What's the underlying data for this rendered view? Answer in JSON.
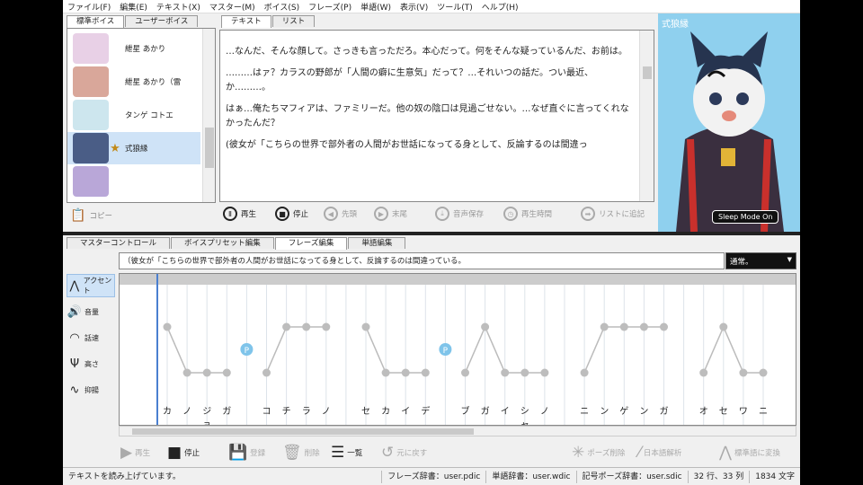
{
  "menu": [
    "ファイル(F)",
    "編集(E)",
    "テキスト(X)",
    "マスター(M)",
    "ボイス(S)",
    "フレーズ(P)",
    "単語(W)",
    "表示(V)",
    "ツール(T)",
    "ヘルプ(H)"
  ],
  "voice_tabs": [
    "標準ボイス",
    "ユーザーボイス"
  ],
  "voices": [
    {
      "name": "紲星 あかり",
      "star": "",
      "color": "#e8d0e6"
    },
    {
      "name": "紲星 あかり（雷",
      "star": "",
      "color": "#d9a79a"
    },
    {
      "name": "タンゲ コトエ",
      "star": "",
      "color": "#cde6ee"
    },
    {
      "name": "式狼縁",
      "star": "★",
      "color": "#4a5d86"
    },
    {
      "name": "",
      "star": "",
      "color": "#b9a7d8"
    }
  ],
  "copy_label": "コピー",
  "text_tabs": [
    "テキスト",
    "リスト"
  ],
  "text_lines": [
    "…なんだ、そんな顔して。さっきも言っただろ。本心だって。何をそんな疑っているんだ、お前は。",
    "………はァ？カラスの野郎が「人間の癖に生意気」だって？…それいつの話だ。つい最近、か………。",
    "はぁ…俺たちマフィアは、ファミリーだ。他の奴の陰口は見過ごせない。…なぜ直ぐに言ってくれなかったんだ？",
    "(彼女が「こちらの世界で部外者の人間がお世話になってる身として、反論するのは間違っ"
  ],
  "controls": [
    {
      "icon": "Ⅱ",
      "label": "再生",
      "dis": false
    },
    {
      "icon": "■",
      "label": "停止",
      "dis": false
    },
    {
      "icon": "◀",
      "label": "先頭",
      "dis": true
    },
    {
      "icon": "▶",
      "label": "末尾",
      "dis": true
    },
    {
      "icon": "⤓",
      "label": "音声保存",
      "dis": true
    },
    {
      "icon": "◷",
      "label": "再生時間",
      "dis": true
    },
    {
      "icon": "➡",
      "label": "リストに追記",
      "dis": true
    }
  ],
  "portrait_name": "式狼縁",
  "sleep_mode": "Sleep Mode On",
  "lower_tabs": [
    "マスターコントロール",
    "ボイスプリセット編集",
    "フレーズ編集",
    "単語編集"
  ],
  "phrase_text": "（彼女が「こちらの世界で部外者の人間がお世話になってる身として、反論するのは間違っている。",
  "style_select": "通常。",
  "side_items": [
    {
      "icon": "accent-icon",
      "glyph": "⋀",
      "label": "アクセント"
    },
    {
      "icon": "volume-icon",
      "glyph": "🔊",
      "label": "音量"
    },
    {
      "icon": "speed-icon",
      "glyph": "◠",
      "label": "話速"
    },
    {
      "icon": "pitch-icon",
      "glyph": "Ψ",
      "label": "高さ"
    },
    {
      "icon": "intonation-icon",
      "glyph": "∿",
      "label": "抑揚"
    }
  ],
  "kana": [
    "カ",
    "ノ",
    "ジョ",
    "ガ",
    "",
    "コ",
    "チ",
    "ラ",
    "ノ",
    "",
    "セ",
    "カ",
    "イ",
    "デ",
    "",
    "ブ",
    "ガ",
    "イ",
    "シャ",
    "ノ",
    "",
    "ニ",
    "ン",
    "ゲ",
    "ン",
    "ガ",
    "",
    "オ",
    "セ",
    "ワ",
    "ニ"
  ],
  "accent_levels": [
    1,
    0,
    0,
    0,
    null,
    0,
    1,
    1,
    1,
    null,
    1,
    0,
    0,
    0,
    null,
    0,
    1,
    0,
    0,
    0,
    null,
    0,
    1,
    1,
    1,
    1,
    null,
    0,
    1,
    0,
    0
  ],
  "pause_marks": [
    "P",
    "P"
  ],
  "bottom_buttons": [
    {
      "glyph": "▶",
      "label": "再生",
      "dis": true
    },
    {
      "glyph": "■",
      "label": "停止",
      "dis": false
    },
    {
      "glyph": "💾",
      "label": "登録",
      "dis": true
    },
    {
      "glyph": "🗑",
      "label": "削除",
      "dis": true
    },
    {
      "glyph": "☰",
      "label": "一覧",
      "dis": false
    },
    {
      "glyph": "↺",
      "label": "元に戻す",
      "dis": true
    },
    {
      "glyph": "✳",
      "label": "ポーズ削除",
      "dis": true
    },
    {
      "glyph": "⁄",
      "label": "日本語解析",
      "dis": true
    },
    {
      "glyph": "⋀",
      "label": "標準語に変換",
      "dis": true
    }
  ],
  "status": {
    "message": "テキストを読み上げています。",
    "phrase_dict": "フレーズ辞書：user.pdic",
    "word_dict": "単語辞書：user.wdic",
    "symbol_dict": "記号ポーズ辞書：user.sdic",
    "cursor": "32 行、33 列",
    "chars": "1834 文字"
  }
}
